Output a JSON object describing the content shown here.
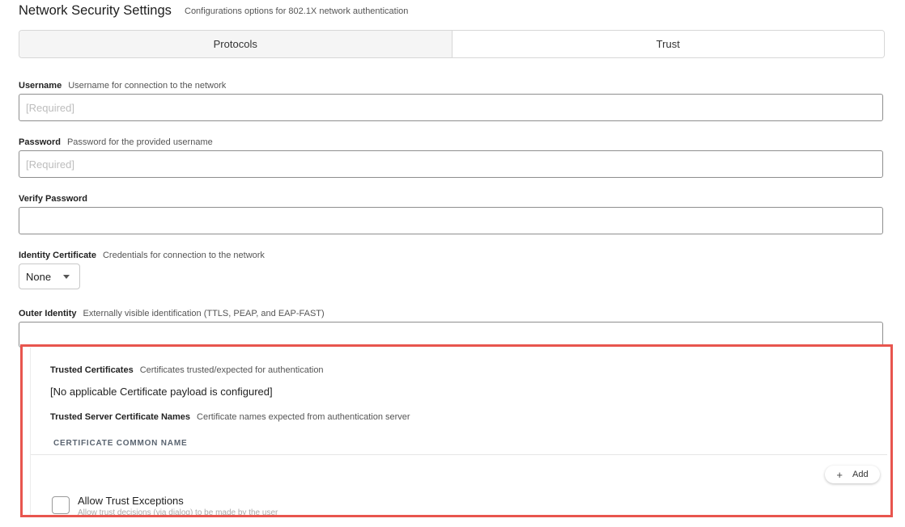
{
  "header": {
    "title": "Network Security Settings",
    "subtitle": "Configurations options for 802.1X network authentication"
  },
  "tabs": [
    {
      "label": "Protocols"
    },
    {
      "label": "Trust"
    }
  ],
  "fields": {
    "username": {
      "label": "Username",
      "hint": "Username for connection to the network",
      "placeholder": "[Required]",
      "value": ""
    },
    "password": {
      "label": "Password",
      "hint": "Password for the provided username",
      "placeholder": "[Required]",
      "value": ""
    },
    "verify_password": {
      "label": "Verify Password",
      "value": ""
    },
    "identity_certificate": {
      "label": "Identity Certificate",
      "hint": "Credentials for connection to the network",
      "selected": "None"
    },
    "outer_identity": {
      "label": "Outer Identity",
      "hint": "Externally visible identification (TTLS, PEAP, and EAP-FAST)",
      "value": ""
    }
  },
  "trust": {
    "trusted_certificates": {
      "label": "Trusted Certificates",
      "hint": "Certificates trusted/expected for authentication"
    },
    "no_payload_message": "[No applicable Certificate payload is configured]",
    "trusted_server_names": {
      "label": "Trusted Server Certificate Names",
      "hint": "Certificate names expected from authentication server"
    },
    "column_header": "CERTIFICATE COMMON NAME",
    "add_button": {
      "icon": "plus-icon",
      "label": "Add"
    },
    "allow_trust_exceptions": {
      "label": "Allow Trust Exceptions",
      "description": "Allow trust decisions (via dialog) to be made by the user",
      "checked": false
    }
  },
  "colors": {
    "highlight_border": "#e8554e"
  }
}
